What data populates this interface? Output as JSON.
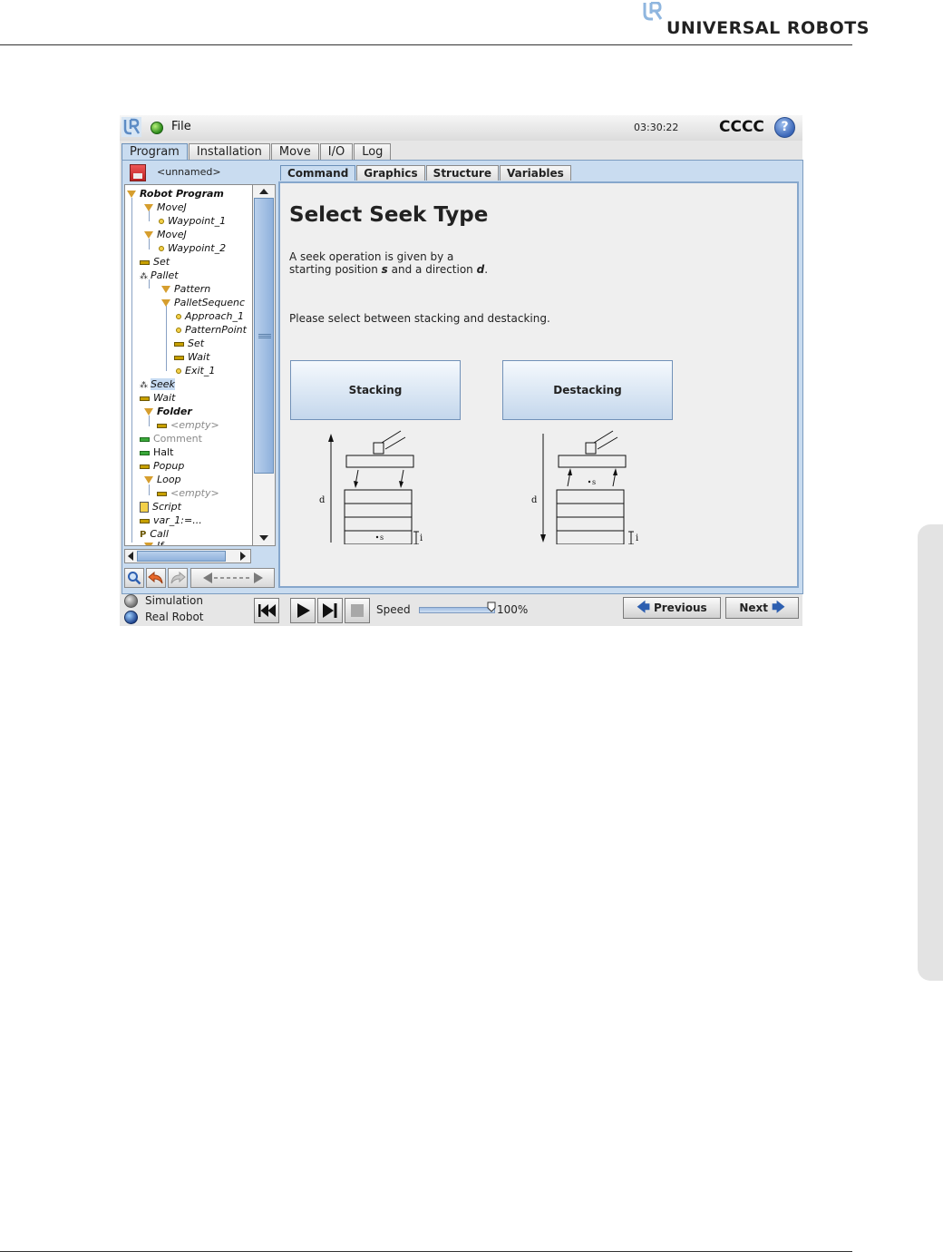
{
  "document": {
    "brand": "UNIVERSAL ROBOTS"
  },
  "app": {
    "file_menu": "File",
    "clock": "03:30:22",
    "robot_name": "CCCC",
    "help_glyph": "?",
    "main_tabs": [
      {
        "label": "Program",
        "active": true
      },
      {
        "label": "Installation",
        "active": false
      },
      {
        "label": "Move",
        "active": false
      },
      {
        "label": "I/O",
        "active": false
      },
      {
        "label": "Log",
        "active": false
      }
    ],
    "program_name": "<unnamed>",
    "tree": [
      {
        "label": "Robot Program",
        "icon": "triangle-icon"
      },
      {
        "label": "MoveJ",
        "icon": "triangle-icon"
      },
      {
        "label": "Waypoint_1",
        "icon": "waypoint-icon"
      },
      {
        "label": "MoveJ",
        "icon": "triangle-icon"
      },
      {
        "label": "Waypoint_2",
        "icon": "waypoint-icon"
      },
      {
        "label": "Set",
        "icon": "bar-icon"
      },
      {
        "label": "Pallet",
        "icon": "pallet-icon"
      },
      {
        "label": "Pattern",
        "icon": "triangle-icon"
      },
      {
        "label": "PalletSequenc",
        "icon": "triangle-icon"
      },
      {
        "label": "Approach_1",
        "icon": "waypoint-icon"
      },
      {
        "label": "PatternPoint",
        "icon": "waypoint-icon"
      },
      {
        "label": "Set",
        "icon": "bar-icon"
      },
      {
        "label": "Wait",
        "icon": "bar-icon"
      },
      {
        "label": "Exit_1",
        "icon": "waypoint-icon"
      },
      {
        "label": "Seek",
        "icon": "pallet-icon",
        "selected": true
      },
      {
        "label": "Wait",
        "icon": "bar-icon"
      },
      {
        "label": "Folder",
        "icon": "triangle-icon"
      },
      {
        "label": "<empty>",
        "icon": "bar-icon"
      },
      {
        "label": "Comment",
        "icon": "bar-icon-green"
      },
      {
        "label": "Halt",
        "icon": "bar-icon-green"
      },
      {
        "label": "Popup",
        "icon": "bar-icon"
      },
      {
        "label": "Loop",
        "icon": "triangle-icon"
      },
      {
        "label": "<empty>",
        "icon": "bar-icon"
      },
      {
        "label": "Script",
        "icon": "script-icon"
      },
      {
        "label": "var_1:=...",
        "icon": "bar-icon"
      },
      {
        "label": "Call",
        "icon": "call-icon"
      },
      {
        "label": "If",
        "icon": "triangle-icon"
      }
    ],
    "sub_tabs": [
      {
        "label": "Command",
        "active": true
      },
      {
        "label": "Graphics",
        "active": false
      },
      {
        "label": "Structure",
        "active": false
      },
      {
        "label": "Variables",
        "active": false
      }
    ],
    "heading": "Select Seek Type",
    "description_line1": "A seek operation is given by a",
    "description_line2_pre": "starting position ",
    "description_s": "s",
    "description_line2_mid": " and a direction ",
    "description_d": "d",
    "description_line2_end": ".",
    "instruction": "Please select between stacking and destacking.",
    "stacking_button": "Stacking",
    "destacking_button": "Destacking",
    "diagram_labels": {
      "d": "d",
      "i": "i",
      "s": "s"
    },
    "simulation_label": "Simulation",
    "real_robot_label": "Real Robot",
    "speed_label": "Speed",
    "speed_value": "100%",
    "speed_fraction": 1.0,
    "previous_button": "Previous",
    "next_button": "Next"
  }
}
